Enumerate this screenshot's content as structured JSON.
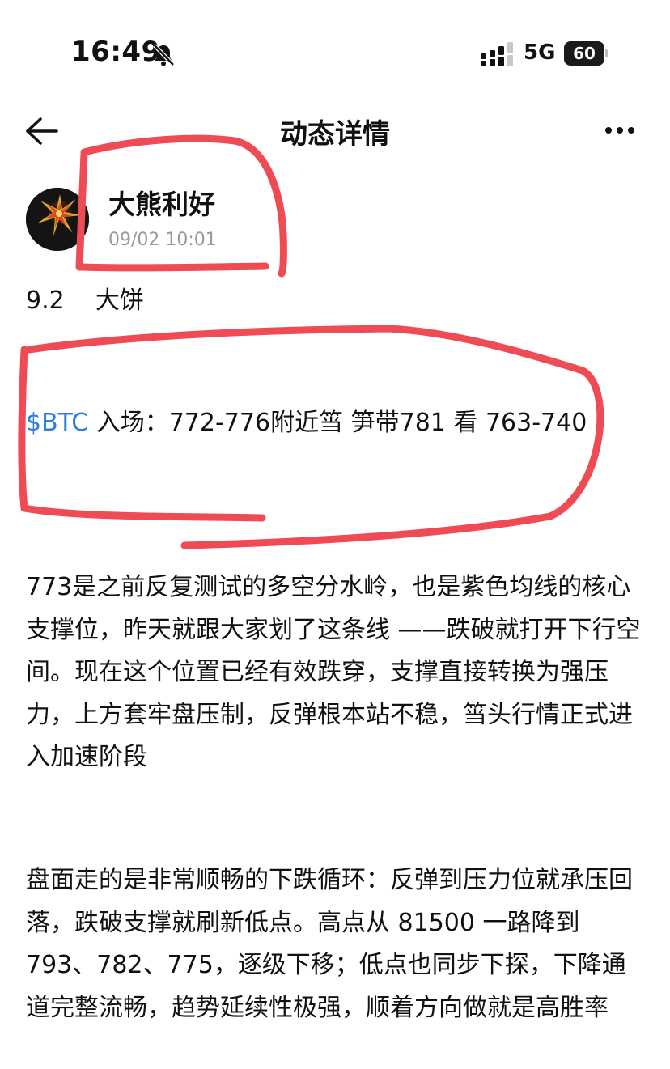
{
  "status_bar": {
    "time": "16:49",
    "network": "5G",
    "battery": "60"
  },
  "icons": {
    "bell_muted": "bell-slash-icon",
    "signal": "cellular-signal-icon",
    "back": "arrow-left-icon",
    "more": "more-dots-icon",
    "avatar": "avatar-image"
  },
  "nav": {
    "title": "动态详情"
  },
  "author": {
    "name": "大熊利好",
    "time": "09/02 10:01"
  },
  "post": {
    "title": "9.2    大饼",
    "ticker": "$BTC",
    "signal_text": "  入场：772-776附近筜      笋带781      看 763-740",
    "paragraphs": [
      "773是之前反复测试的多空分水岭，也是紫色均线的核心支撑位，昨天就跟大家划了这条线 ——跌破就打开下行空间。现在这个位置已经有效跌穿，支撑直接转换为强压力，上方套牢盘压制，反弹根本站不稳，筜头行情正式进入加速阶段",
      "盘面走的是非常顺畅的下跌循环：反弹到压力位就承压回落，跌破支撑就刷新低点。高点从 81500 一路降到 793、782、775，逐级下移；低点也同步下探，下降通道完整流畅，趋势延续性极强，顺着方向做就是高胜率"
    ]
  },
  "colors": {
    "marker": "#ef4b55",
    "link": "#2b7fe0",
    "muted_text": "#9a9a9a"
  }
}
